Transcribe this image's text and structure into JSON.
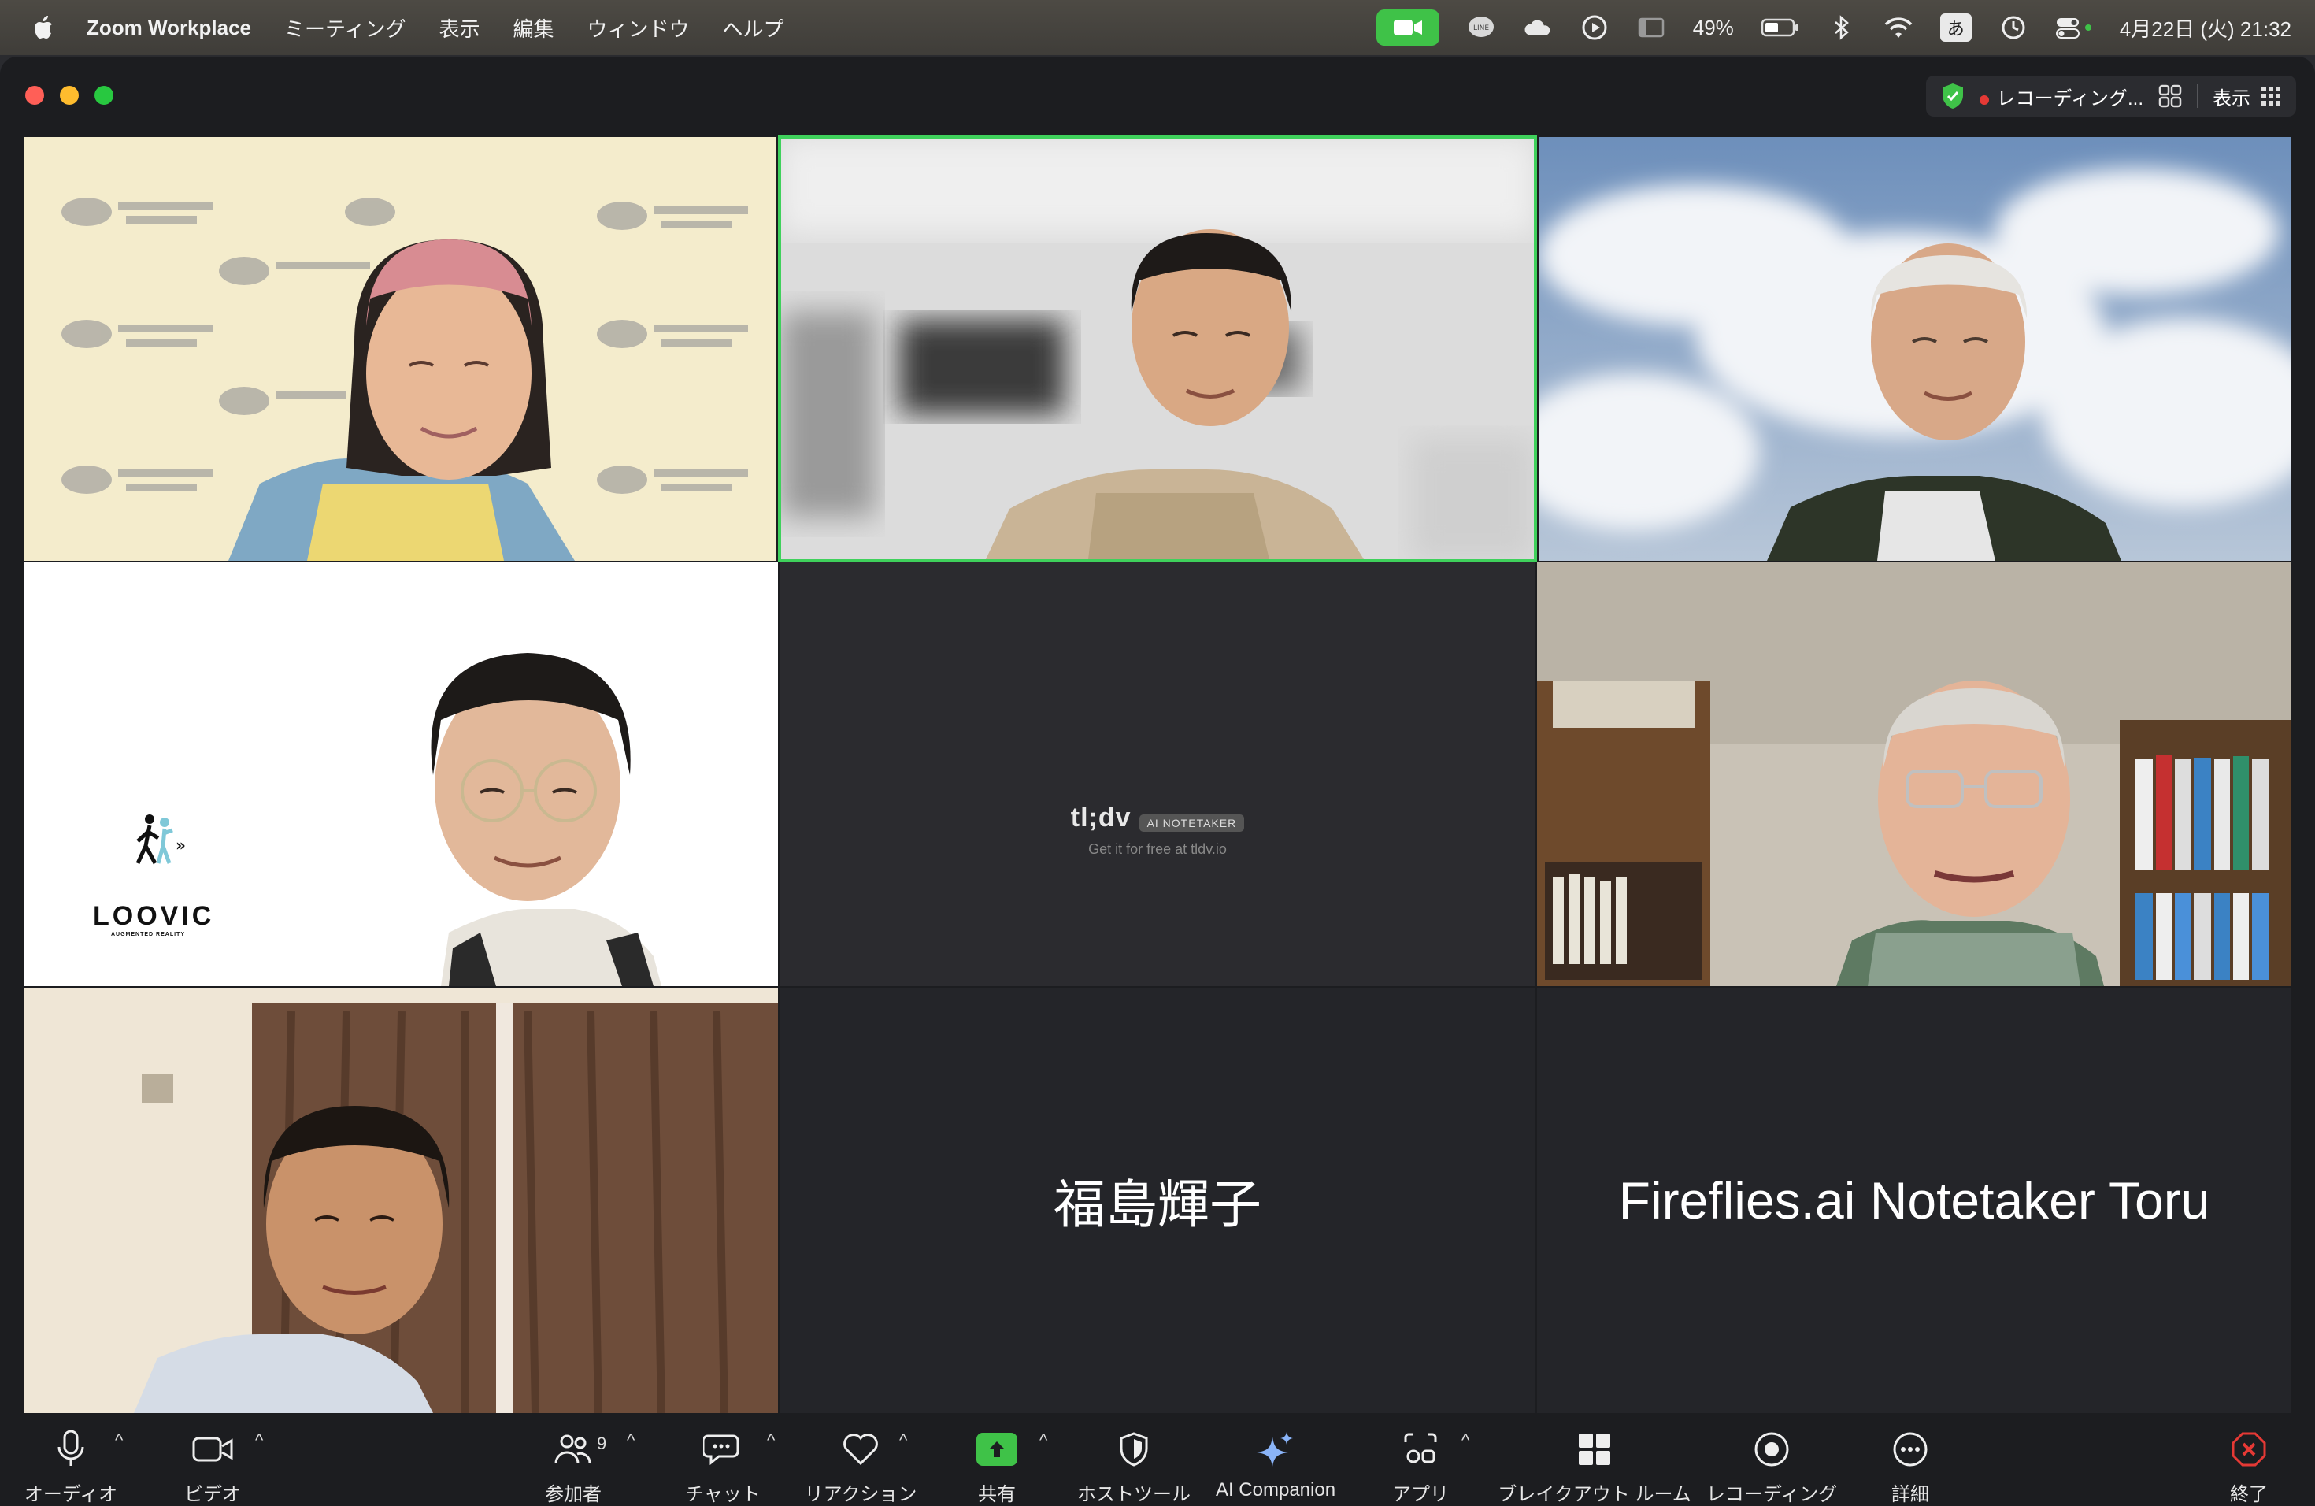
{
  "menubar": {
    "app_name": "Zoom Workplace",
    "menus": [
      "ミーティング",
      "表示",
      "編集",
      "ウィンドウ",
      "ヘルプ"
    ],
    "battery": "49%",
    "ime": "あ",
    "datetime": "4月22日 (火)  21:32"
  },
  "titlebar": {
    "recording_label": "レコーディング...",
    "view_label": "表示"
  },
  "participants": [
    {
      "id": "p1",
      "type": "video",
      "description": "woman-with-headband"
    },
    {
      "id": "p2",
      "type": "video",
      "active_speaker": true
    },
    {
      "id": "p3",
      "type": "video"
    },
    {
      "id": "p4",
      "type": "video",
      "logo_text": "LOOVIC",
      "logo_sub": "AUGMENTED REALITY"
    },
    {
      "id": "p5",
      "type": "video",
      "logo_text": "tl;dv",
      "badge": "AI NOTETAKER",
      "sub": "Get it for free at tldv.io"
    },
    {
      "id": "p6",
      "type": "video"
    },
    {
      "id": "p7",
      "type": "video"
    },
    {
      "id": "p8",
      "type": "name",
      "name": "福島輝子"
    },
    {
      "id": "p9",
      "type": "name",
      "name": "Fireflies.ai Notetaker Toru"
    }
  ],
  "toolbar": {
    "audio": "オーディオ",
    "video": "ビデオ",
    "participants": "参加者",
    "participants_count": "9",
    "chat": "チャット",
    "reactions": "リアクション",
    "share": "共有",
    "host_tools": "ホストツール",
    "ai_companion": "AI Companion",
    "apps": "アプリ",
    "breakout": "ブレイクアウト ルーム",
    "recording": "レコーディング",
    "more": "詳細",
    "end": "終了"
  },
  "colors": {
    "share_green": "#3fc248",
    "active_border": "#3fd15c",
    "end_red": "#e53935"
  }
}
